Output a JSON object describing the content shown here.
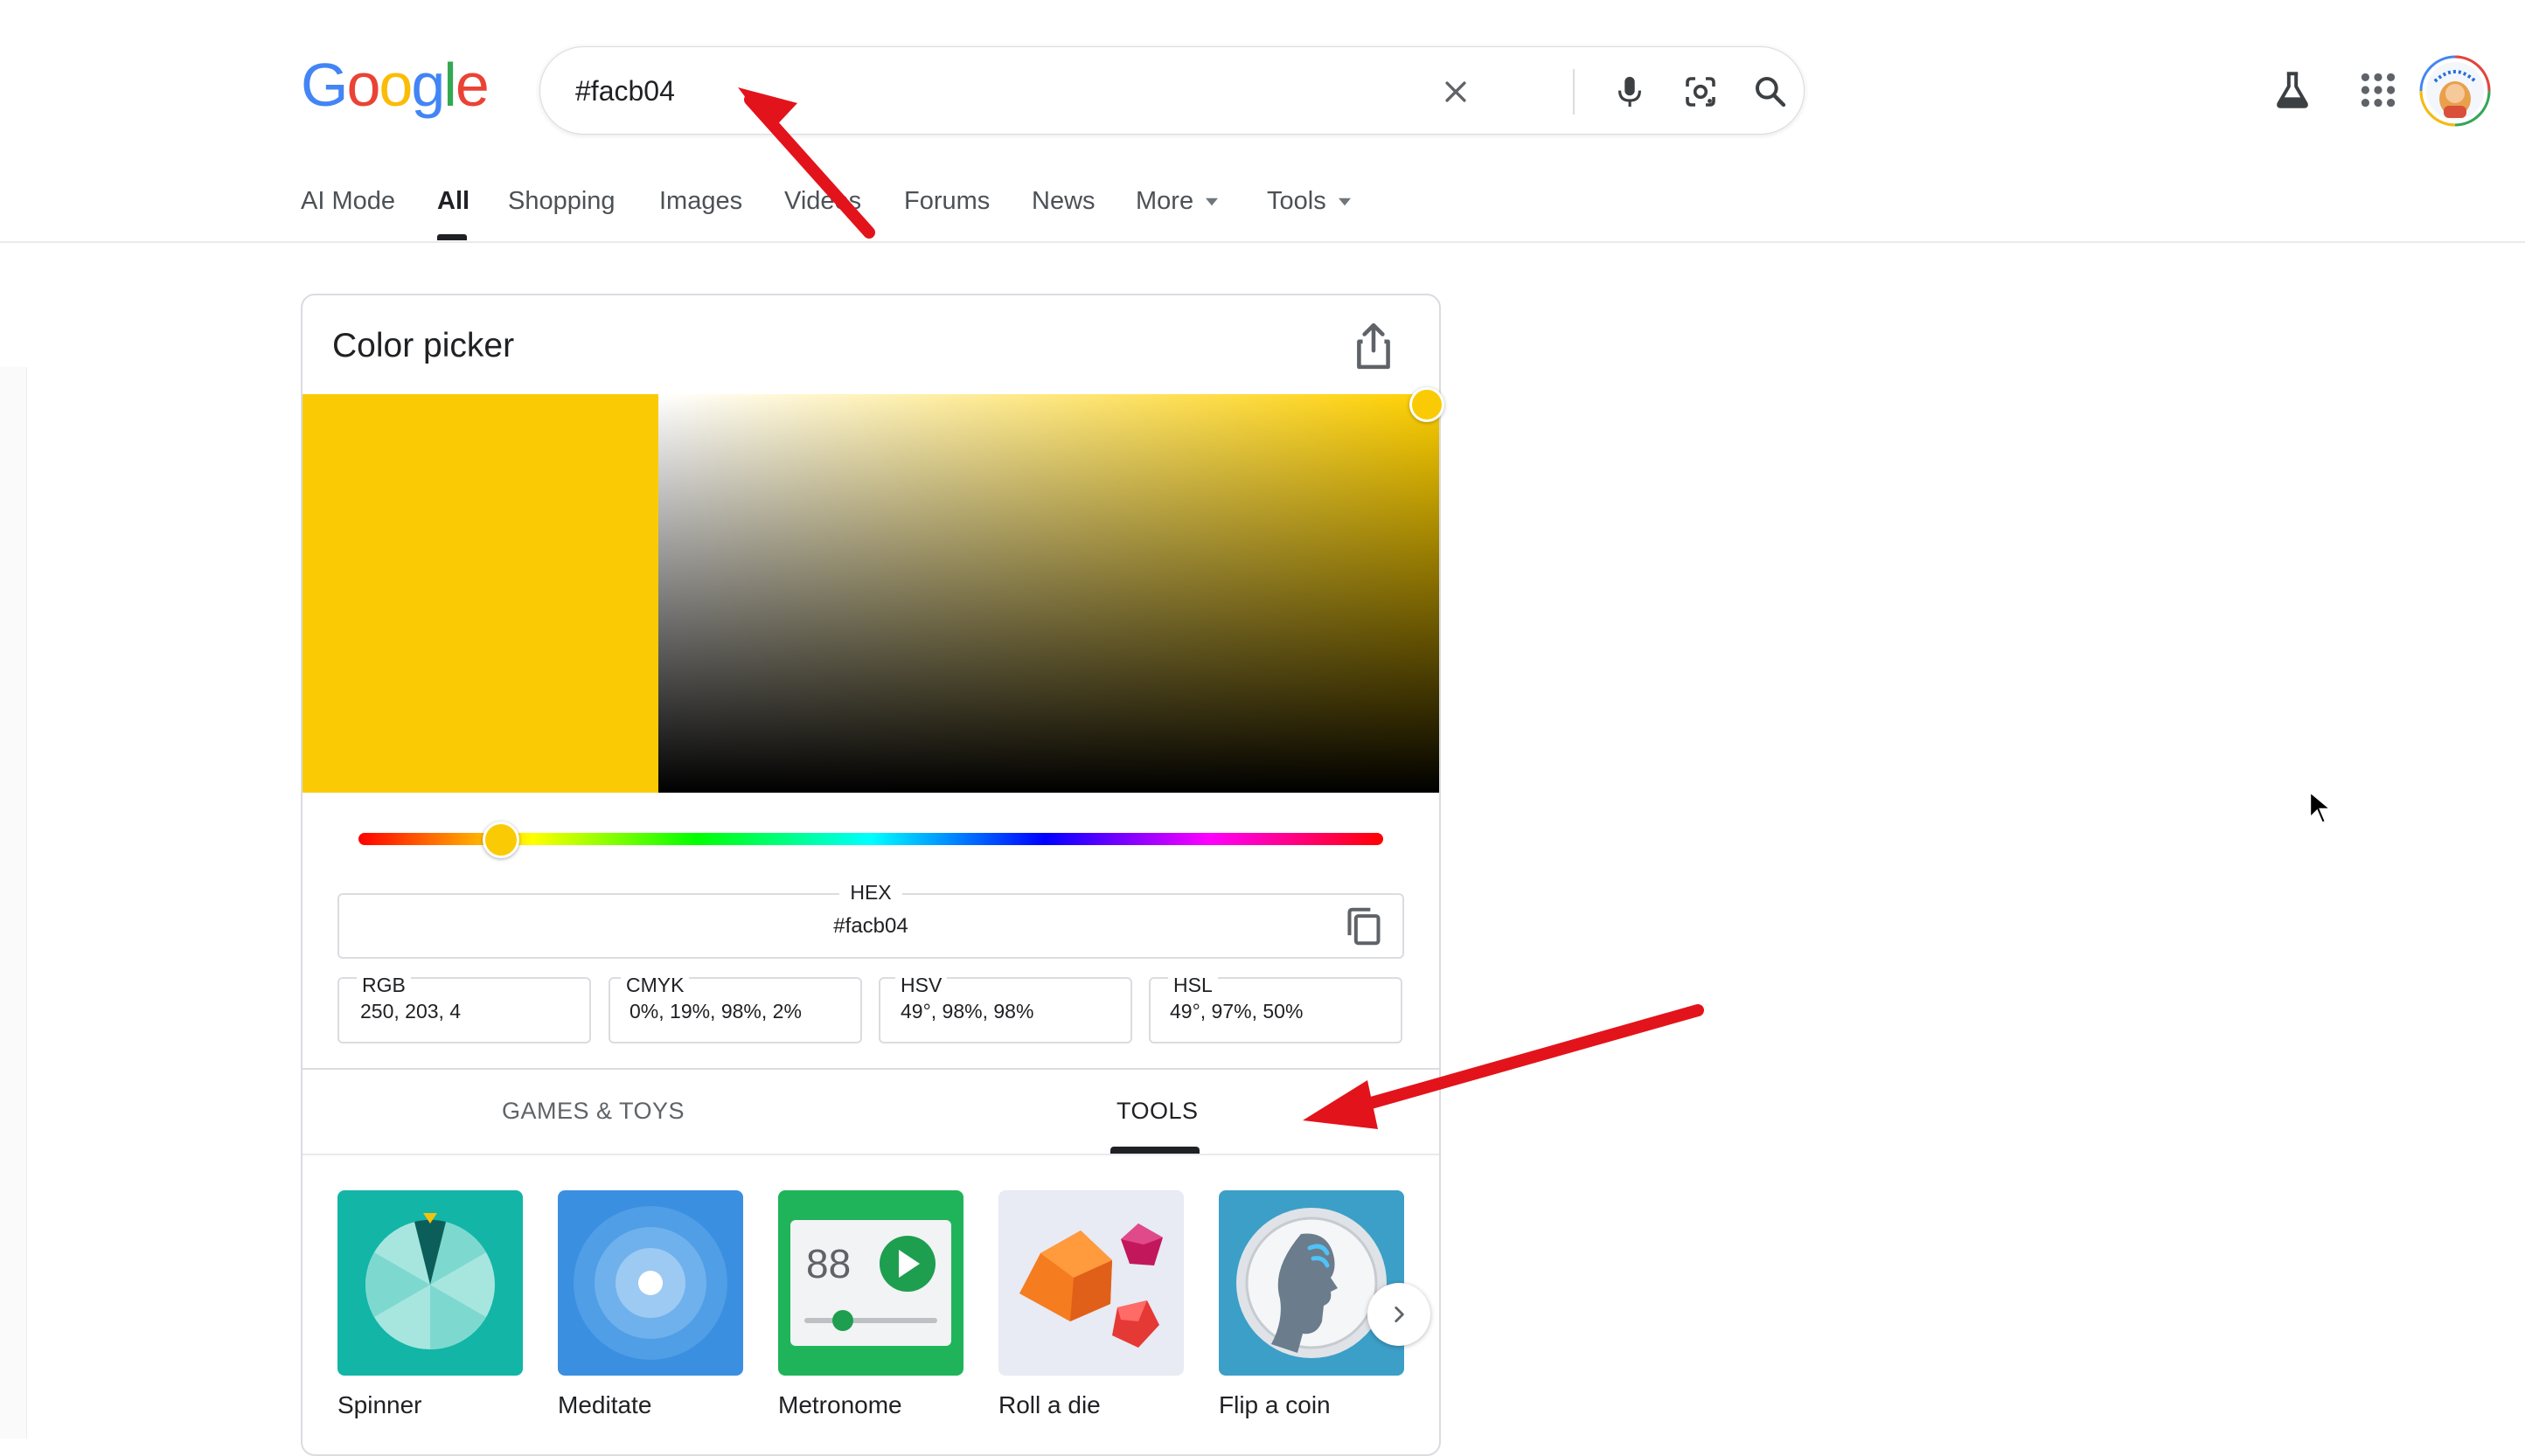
{
  "header": {
    "logo_text": "Google",
    "logo_colors": [
      "#4285F4",
      "#EA4335",
      "#FBBC05",
      "#4285F4",
      "#34A853",
      "#EA4335"
    ],
    "search": {
      "value": "#facb04"
    },
    "icons": [
      "close-icon",
      "microphone-icon",
      "lens-icon",
      "search-icon",
      "labs-flask-icon",
      "apps-grid-icon"
    ]
  },
  "nav": {
    "tabs": [
      {
        "label": "AI Mode"
      },
      {
        "label": "All"
      },
      {
        "label": "Shopping"
      },
      {
        "label": "Images"
      },
      {
        "label": "Videos"
      },
      {
        "label": "Forums"
      },
      {
        "label": "News"
      },
      {
        "label": "More"
      },
      {
        "label": "Tools"
      }
    ],
    "active": "All"
  },
  "color_picker": {
    "title": "Color picker",
    "selected_color": "#facb04",
    "hue_deg": 49,
    "saturation_pct": 98,
    "value_pct": 98,
    "hex": {
      "label": "HEX",
      "value": "#facb04"
    },
    "rgb": {
      "label": "RGB",
      "value": "250, 203, 4"
    },
    "cmyk": {
      "label": "CMYK",
      "value": "0%, 19%, 98%, 2%"
    },
    "hsv": {
      "label": "HSV",
      "value": "49°, 98%, 98%"
    },
    "hsl": {
      "label": "HSL",
      "value": "49°, 97%, 50%"
    }
  },
  "sections": {
    "tabs": [
      {
        "label": "GAMES & TOYS"
      },
      {
        "label": "TOOLS"
      }
    ],
    "active": "TOOLS"
  },
  "tools": [
    {
      "label": "Spinner",
      "bg": "#12b5a6"
    },
    {
      "label": "Meditate",
      "bg": "#3b8fe0"
    },
    {
      "label": "Metronome",
      "bg": "#1fb45a",
      "display": "88"
    },
    {
      "label": "Roll a die",
      "bg": "#e8eaf4"
    },
    {
      "label": "Flip a coin",
      "bg": "#3c9fc7"
    }
  ],
  "annotation_color": "#e3131b"
}
